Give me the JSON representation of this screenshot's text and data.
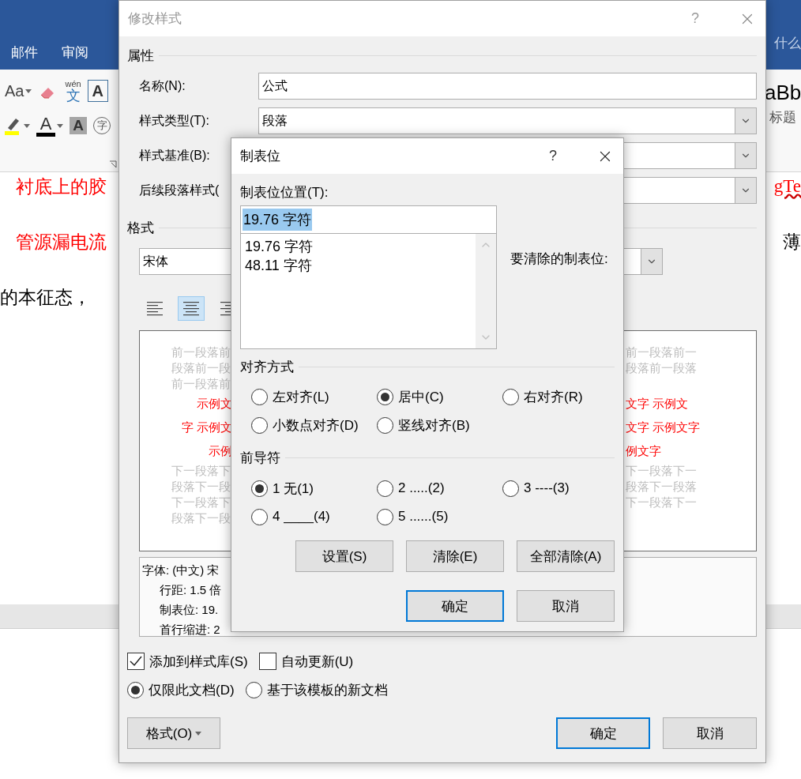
{
  "word": {
    "tabs": [
      {
        "label": "邮件"
      },
      {
        "label": "审阅"
      }
    ],
    "tell_me": "什么",
    "ribbon": [
      [
        {
          "kind": "case",
          "text": "Aa"
        },
        {
          "kind": "clear_format"
        },
        {
          "kind": "phonetic",
          "top": "wén",
          "text": "文"
        },
        {
          "kind": "boxed",
          "text": "A"
        }
      ],
      [
        {
          "kind": "highlight"
        },
        {
          "kind": "font_color",
          "text": "A"
        },
        {
          "kind": "shaded",
          "text": "A"
        },
        {
          "kind": "enclosed",
          "text": "字"
        }
      ]
    ],
    "style_gallery": {
      "sample": "aBb",
      "name": "标题"
    },
    "doc_rows": [
      {
        "left": {
          "text": "衬底上的胶",
          "color": "#ff0000"
        },
        "right": {
          "text": "gTe",
          "color": "#ff0000",
          "flagged": true
        }
      },
      {
        "left": {
          "text": "管源漏电流",
          "color": "#ff0000"
        },
        "right": {
          "text": "薄",
          "color": "#000000",
          "flagged": false
        }
      },
      {
        "left": {
          "text": "的本征态，",
          "color": "#000000"
        }
      }
    ]
  },
  "modify_style": {
    "title": "修改样式",
    "help": "?",
    "properties_heading": "属性",
    "fields": [
      {
        "label": "名称(N):",
        "kind": "text",
        "value": "公式"
      },
      {
        "label": "样式类型(T):",
        "kind": "combo",
        "value": "段落"
      },
      {
        "label": "样式基准(B):",
        "kind": "combo"
      },
      {
        "label": "后续段落样式(",
        "kind": "combo"
      }
    ],
    "format_heading": "格式",
    "font": "宋体",
    "alignment": [
      {
        "kind": "left",
        "selected": false
      },
      {
        "kind": "center",
        "selected": true
      },
      {
        "kind": "right",
        "selected": false
      }
    ],
    "preview": [
      {
        "kind": "before",
        "left": "前一段落前",
        "right": "前一段落前一"
      },
      {
        "kind": "before",
        "left": "段落前一段",
        "right": "段落前一段落"
      },
      {
        "kind": "before",
        "left": "前一段落前"
      },
      {
        "kind": "sample",
        "left": "示例文",
        "right": "文字  示例文"
      },
      {
        "kind": "sample",
        "left": "字  示例文",
        "right": "文字  示例文字"
      },
      {
        "kind": "sample",
        "left": "示例",
        "right": "例文字"
      },
      {
        "kind": "after",
        "left": "下一段落下",
        "right": "下一段落下一"
      },
      {
        "kind": "after",
        "left": "段落下一段",
        "right": "段落下一段落"
      },
      {
        "kind": "after",
        "left": "下一段落下",
        "right": "下一段落下一"
      },
      {
        "kind": "after",
        "left": "段落下一段"
      }
    ],
    "description": [
      {
        "kind": "head",
        "text": "字体: (中文) 宋"
      },
      {
        "kind": "detail",
        "text": "行距: 1.5 倍"
      },
      {
        "kind": "detail",
        "text": "制表位: 19."
      },
      {
        "kind": "detail",
        "text": "首行缩进: 2"
      }
    ],
    "options": [
      {
        "label": "添加到样式库(S)",
        "checked": true
      },
      {
        "label": "自动更新(U)",
        "checked": false
      }
    ],
    "scope": [
      {
        "label": "仅限此文档(D)",
        "selected": true
      },
      {
        "label": "基于该模板的新文档",
        "selected": false
      }
    ],
    "format_button": "格式(O)",
    "ok": "确定",
    "cancel": "取消"
  },
  "tabs_dialog": {
    "title": "制表位",
    "help": "?",
    "position_label": "制表位位置(T):",
    "position_value": "19.76 字符",
    "positions": [
      {
        "text": "19.76 字符"
      },
      {
        "text": "48.11 字符"
      }
    ],
    "clear_label": "要清除的制表位:",
    "alignment_heading": "对齐方式",
    "alignment": [
      {
        "label": "左对齐(L)",
        "selected": false
      },
      {
        "label": "居中(C)",
        "selected": true
      },
      {
        "label": "右对齐(R)",
        "selected": false
      },
      {
        "label": "小数点对齐(D)",
        "selected": false
      },
      {
        "label": "竖线对齐(B)",
        "selected": false
      }
    ],
    "leader_heading": "前导符",
    "leaders": [
      {
        "label": "1 无(1)",
        "selected": true
      },
      {
        "label": "2 .....(2)",
        "selected": false
      },
      {
        "label": "3 ----(3)",
        "selected": false
      },
      {
        "label": "4 ____(4)",
        "selected": false
      },
      {
        "label": "5 ......(5)",
        "selected": false
      }
    ],
    "buttons": [
      "设置(S)",
      "清除(E)",
      "全部清除(A)"
    ],
    "ok": "确定",
    "cancel": "取消"
  }
}
